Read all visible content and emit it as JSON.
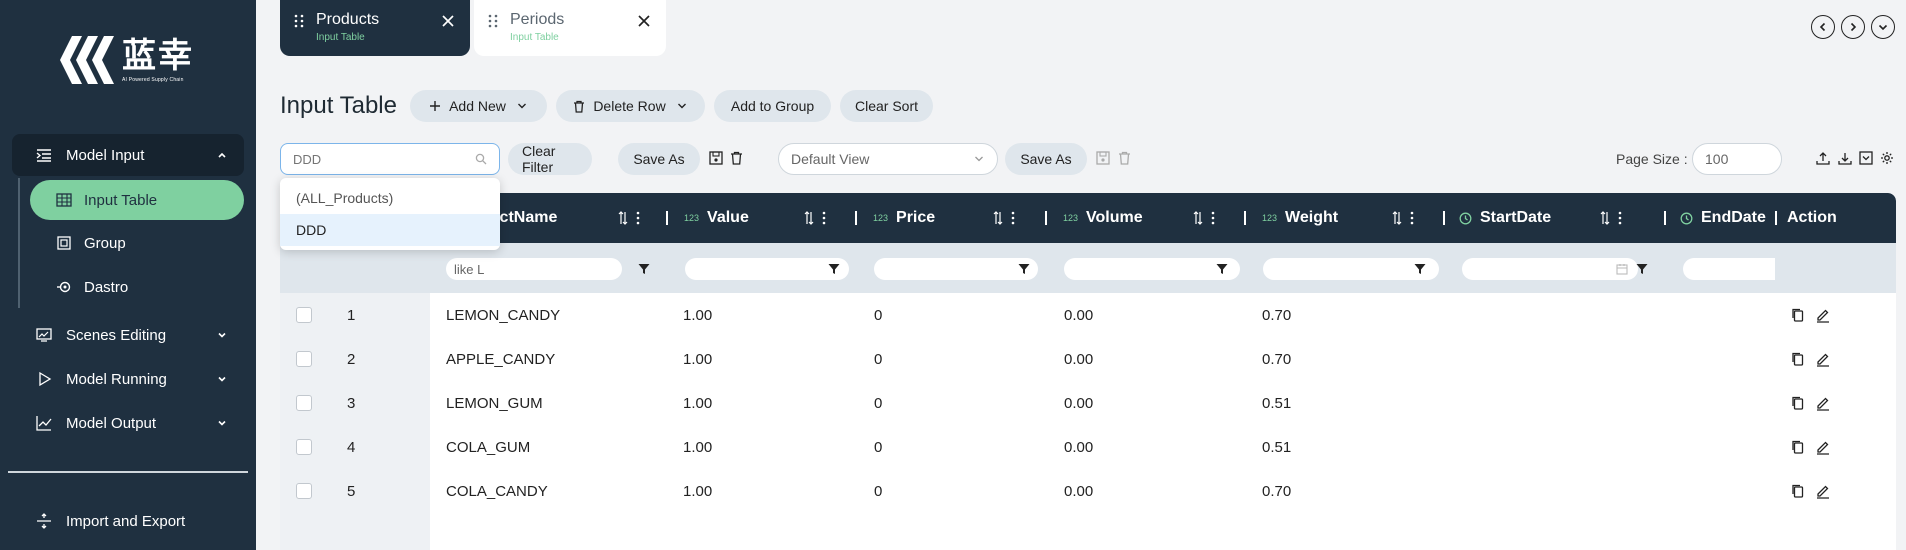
{
  "brand": {
    "name_cn": "蓝幸",
    "tagline": "AI Powered Supply Chain"
  },
  "sidebar": {
    "sections": [
      {
        "label": "Model Input",
        "expanded": true,
        "icon": "list-indent-icon"
      },
      {
        "label": "Scenes Editing",
        "icon": "monitor-chart-icon"
      },
      {
        "label": "Model Running",
        "icon": "play-icon"
      },
      {
        "label": "Model Output",
        "icon": "line-chart-icon"
      }
    ],
    "sub_items": [
      {
        "label": "Input Table",
        "active": true,
        "icon": "table-icon"
      },
      {
        "label": "Group",
        "icon": "group-icon"
      },
      {
        "label": "Dastro",
        "icon": "dastro-icon"
      }
    ],
    "footer_item": {
      "label": "Import and Export",
      "icon": "split-icon"
    }
  },
  "tabs": [
    {
      "title": "Products",
      "subtitle": "Input Table",
      "active": true
    },
    {
      "title": "Periods",
      "subtitle": "Input Table",
      "active": false
    }
  ],
  "page": {
    "title": "Input Table"
  },
  "toolbar": {
    "add_new": "Add New",
    "delete_row": "Delete Row",
    "add_to_group": "Add to Group",
    "clear_sort": "Clear Sort"
  },
  "filterbar": {
    "search_placeholder": "DDD",
    "clear_filter": "Clear Filter",
    "save_as": "Save As",
    "view": "Default View",
    "save_as_2": "Save As",
    "page_size_label": "Page Size :",
    "page_size": "100"
  },
  "dropdown": {
    "options": [
      "(ALL_Products)",
      "DDD"
    ],
    "selected": "DDD"
  },
  "table": {
    "columns": [
      {
        "label": "ductName",
        "type": ""
      },
      {
        "label": "Value",
        "type": "123"
      },
      {
        "label": "Price",
        "type": "123"
      },
      {
        "label": "Volume",
        "type": "123"
      },
      {
        "label": "Weight",
        "type": "123"
      },
      {
        "label": "StartDate",
        "type": "clock"
      },
      {
        "label": "EndDate",
        "type": "clock"
      },
      {
        "label": "Action",
        "type": ""
      }
    ],
    "filter_name_value": "like L",
    "rows": [
      {
        "id": "1",
        "name": "LEMON_CANDY",
        "value": "1.00",
        "price": "0",
        "volume": "0.00",
        "weight": "0.70"
      },
      {
        "id": "2",
        "name": "APPLE_CANDY",
        "value": "1.00",
        "price": "0",
        "volume": "0.00",
        "weight": "0.70"
      },
      {
        "id": "3",
        "name": "LEMON_GUM",
        "value": "1.00",
        "price": "0",
        "volume": "0.00",
        "weight": "0.51"
      },
      {
        "id": "4",
        "name": "COLA_GUM",
        "value": "1.00",
        "price": "0",
        "volume": "0.00",
        "weight": "0.51"
      },
      {
        "id": "5",
        "name": "COLA_CANDY",
        "value": "1.00",
        "price": "0",
        "volume": "0.00",
        "weight": "0.70"
      }
    ]
  },
  "colors": {
    "sidebar_bg": "#1f3040",
    "accent_green": "#7fd0a0",
    "pill_bg": "#dfe6ec",
    "focus_blue": "#7cb5ea"
  }
}
